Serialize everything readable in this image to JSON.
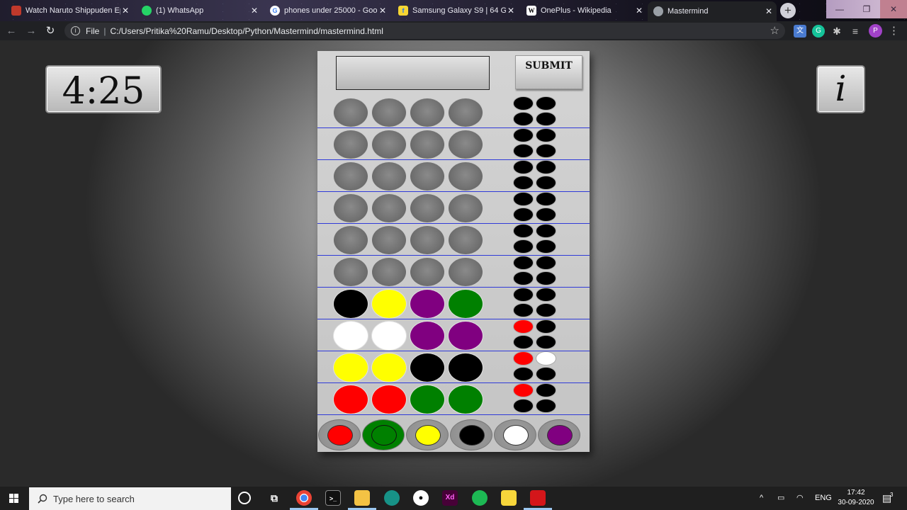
{
  "browser": {
    "tabs": [
      {
        "title": "Watch Naruto Shippuden Ep",
        "icon": "naruto-favicon",
        "color": "#c0392b"
      },
      {
        "title": "(1) WhatsApp",
        "icon": "whatsapp-favicon",
        "color": "#25d366"
      },
      {
        "title": "phones under 25000 - Goog",
        "icon": "google-favicon",
        "color": "#ffffff"
      },
      {
        "title": "Samsung Galaxy S9 | 64 GB",
        "icon": "flipkart-favicon",
        "color": "#f7d633"
      },
      {
        "title": "OnePlus - Wikipedia",
        "icon": "wikipedia-favicon",
        "color": "#ffffff"
      },
      {
        "title": "Mastermind",
        "icon": "globe-favicon",
        "color": "#9aa0a6",
        "active": true
      }
    ],
    "url_scheme": "File",
    "url": "C:/Users/Pritika%20Ramu/Desktop/Python/Mastermind/mastermind.html",
    "profile_initial": "P"
  },
  "game": {
    "timer": "4:25",
    "info_label": "i",
    "submit_label": "SUBMIT",
    "colors": {
      "red": "#ff0000",
      "green": "#008000",
      "yellow": "#ffff00",
      "black": "#000000",
      "white": "#ffffff",
      "purple": "#800080",
      "empty": "#6e6e6e",
      "key_empty": "#000000",
      "board_line": "#2f3ad8"
    },
    "guess_rows": [
      {
        "pegs": [
          "empty",
          "empty",
          "empty",
          "empty"
        ],
        "keys": [
          "black",
          "black",
          "black",
          "black"
        ]
      },
      {
        "pegs": [
          "empty",
          "empty",
          "empty",
          "empty"
        ],
        "keys": [
          "black",
          "black",
          "black",
          "black"
        ]
      },
      {
        "pegs": [
          "empty",
          "empty",
          "empty",
          "empty"
        ],
        "keys": [
          "black",
          "black",
          "black",
          "black"
        ]
      },
      {
        "pegs": [
          "empty",
          "empty",
          "empty",
          "empty"
        ],
        "keys": [
          "black",
          "black",
          "black",
          "black"
        ]
      },
      {
        "pegs": [
          "empty",
          "empty",
          "empty",
          "empty"
        ],
        "keys": [
          "black",
          "black",
          "black",
          "black"
        ]
      },
      {
        "pegs": [
          "empty",
          "empty",
          "empty",
          "empty"
        ],
        "keys": [
          "black",
          "black",
          "black",
          "black"
        ]
      },
      {
        "pegs": [
          "black",
          "yellow",
          "purple",
          "green"
        ],
        "keys": [
          "black",
          "black",
          "black",
          "black"
        ]
      },
      {
        "pegs": [
          "white",
          "white",
          "purple",
          "purple"
        ],
        "keys": [
          "red",
          "black",
          "black",
          "black"
        ]
      },
      {
        "pegs": [
          "yellow",
          "yellow",
          "black",
          "black"
        ],
        "keys": [
          "red",
          "white",
          "black",
          "black"
        ]
      },
      {
        "pegs": [
          "red",
          "red",
          "green",
          "green"
        ],
        "keys": [
          "red",
          "black",
          "black",
          "black"
        ]
      }
    ],
    "palette": [
      "red",
      "green",
      "yellow",
      "black",
      "white",
      "purple"
    ],
    "palette_selected": "green"
  },
  "taskbar": {
    "search_placeholder": "Type here to search",
    "apps": [
      "cortana-icon",
      "task-view-icon",
      "chrome-icon",
      "terminal-icon",
      "file-explorer-icon",
      "gitkraken-icon",
      "github-icon",
      "adobe-xd-icon",
      "spotify-icon",
      "sticky-notes-icon",
      "acrobat-icon"
    ],
    "language": "ENG",
    "time": "17:42",
    "date": "30-09-2020",
    "notification_count": "3"
  }
}
